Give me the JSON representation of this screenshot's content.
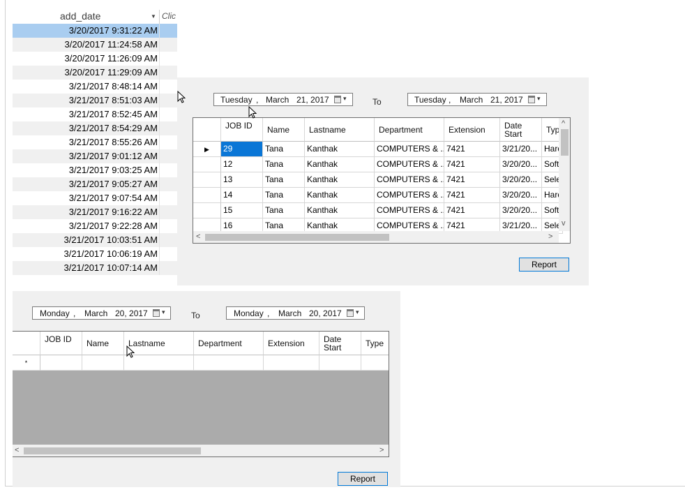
{
  "date_list": {
    "column_header": "add_date",
    "next_column_partial": "Clic",
    "rows": [
      "3/20/2017 9:31:22 AM",
      "3/20/2017 11:24:58 AM",
      "3/20/2017 11:26:09 AM",
      "3/20/2017 11:29:09 AM",
      "3/21/2017 8:48:14 AM",
      "3/21/2017 8:51:03 AM",
      "3/21/2017 8:52:45 AM",
      "3/21/2017 8:54:29 AM",
      "3/21/2017 8:55:26 AM",
      "3/21/2017 9:01:12 AM",
      "3/21/2017 9:03:25 AM",
      "3/21/2017 9:05:27 AM",
      "3/21/2017 9:07:54 AM",
      "3/21/2017 9:16:22 AM",
      "3/21/2017 9:22:28 AM",
      "3/21/2017 10:03:51 AM",
      "3/21/2017 10:06:19 AM",
      "3/21/2017 10:07:14 AM"
    ]
  },
  "panel_top": {
    "from_date": {
      "weekday": "Tuesday",
      "sep": ",",
      "month": "March",
      "day_year": "21, 2017"
    },
    "to_label": "To",
    "to_date": {
      "weekday": "Tuesday",
      "sep": ",",
      "month": "March",
      "day_year": "21, 2017"
    },
    "columns": [
      "JOB ID",
      "Name",
      "Lastname",
      "Department",
      "Extension",
      "Date Start",
      "Typ"
    ],
    "rows": [
      [
        "29",
        "Tana",
        "Kanthak",
        "COMPUTERS & ...",
        "7421",
        "3/21/20...",
        "Hard"
      ],
      [
        "12",
        "Tana",
        "Kanthak",
        "COMPUTERS & ...",
        "7421",
        "3/20/20...",
        "Soft"
      ],
      [
        "13",
        "Tana",
        "Kanthak",
        "COMPUTERS & ...",
        "7421",
        "3/20/20...",
        "Sele"
      ],
      [
        "14",
        "Tana",
        "Kanthak",
        "COMPUTERS & ...",
        "7421",
        "3/20/20...",
        "Hard"
      ],
      [
        "15",
        "Tana",
        "Kanthak",
        "COMPUTERS & ...",
        "7421",
        "3/20/20...",
        "Soft"
      ],
      [
        "16",
        "Tana",
        "Kanthak",
        "COMPUTERS & ...",
        "7421",
        "3/21/20...",
        "Sele"
      ]
    ],
    "report_label": "Report"
  },
  "panel_bottom": {
    "from_date": {
      "weekday": "Monday",
      "sep": ",",
      "month": "March",
      "day_year": "20, 2017"
    },
    "to_label": "To",
    "to_date": {
      "weekday": "Monday",
      "sep": ",",
      "month": "March",
      "day_year": "20, 2017"
    },
    "columns": [
      "JOB ID",
      "Name",
      "Lastname",
      "Department",
      "Extension",
      "Date Start",
      "Type"
    ],
    "new_row_marker": "*",
    "report_label": "Report"
  },
  "glyphs": {
    "current_row": "▶",
    "scroll_up": "^",
    "scroll_down": "v",
    "scroll_left": "<",
    "scroll_right": ">",
    "dropdown": "▾"
  },
  "colors": {
    "selected_row": "#a9cdf0",
    "selected_cell": "#0a76d6",
    "panel_bg": "#f0f0f0",
    "button_border": "#0078d7",
    "empty_grid": "#ababab"
  }
}
